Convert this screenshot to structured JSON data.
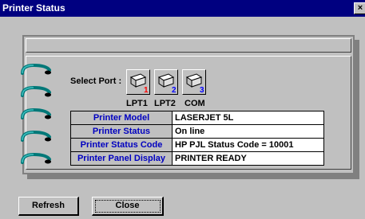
{
  "window": {
    "title": "Printer Status",
    "close_glyph": "×"
  },
  "ports": {
    "label": "Select Port :",
    "items": [
      {
        "name": "LPT1",
        "number": "1",
        "color": "#ff0000",
        "icon": "printer-icon"
      },
      {
        "name": "LPT2",
        "number": "2",
        "color": "#0000ff",
        "icon": "printer-icon"
      },
      {
        "name": "COM",
        "number": "3",
        "color": "#0000ff",
        "icon": "printer-icon"
      }
    ]
  },
  "info": [
    {
      "label": "Printer Model",
      "value": "LASERJET 5L"
    },
    {
      "label": "Printer Status",
      "value": "On line"
    },
    {
      "label": "Printer Status Code",
      "value": "HP PJL Status Code = 10001"
    },
    {
      "label": "Printer Panel Display",
      "value": "PRINTER READY"
    }
  ],
  "buttons": {
    "refresh": "Refresh",
    "close": "Close"
  },
  "colors": {
    "titlebar": "#000080",
    "label_text": "#0000c0",
    "ring": "#007878"
  }
}
